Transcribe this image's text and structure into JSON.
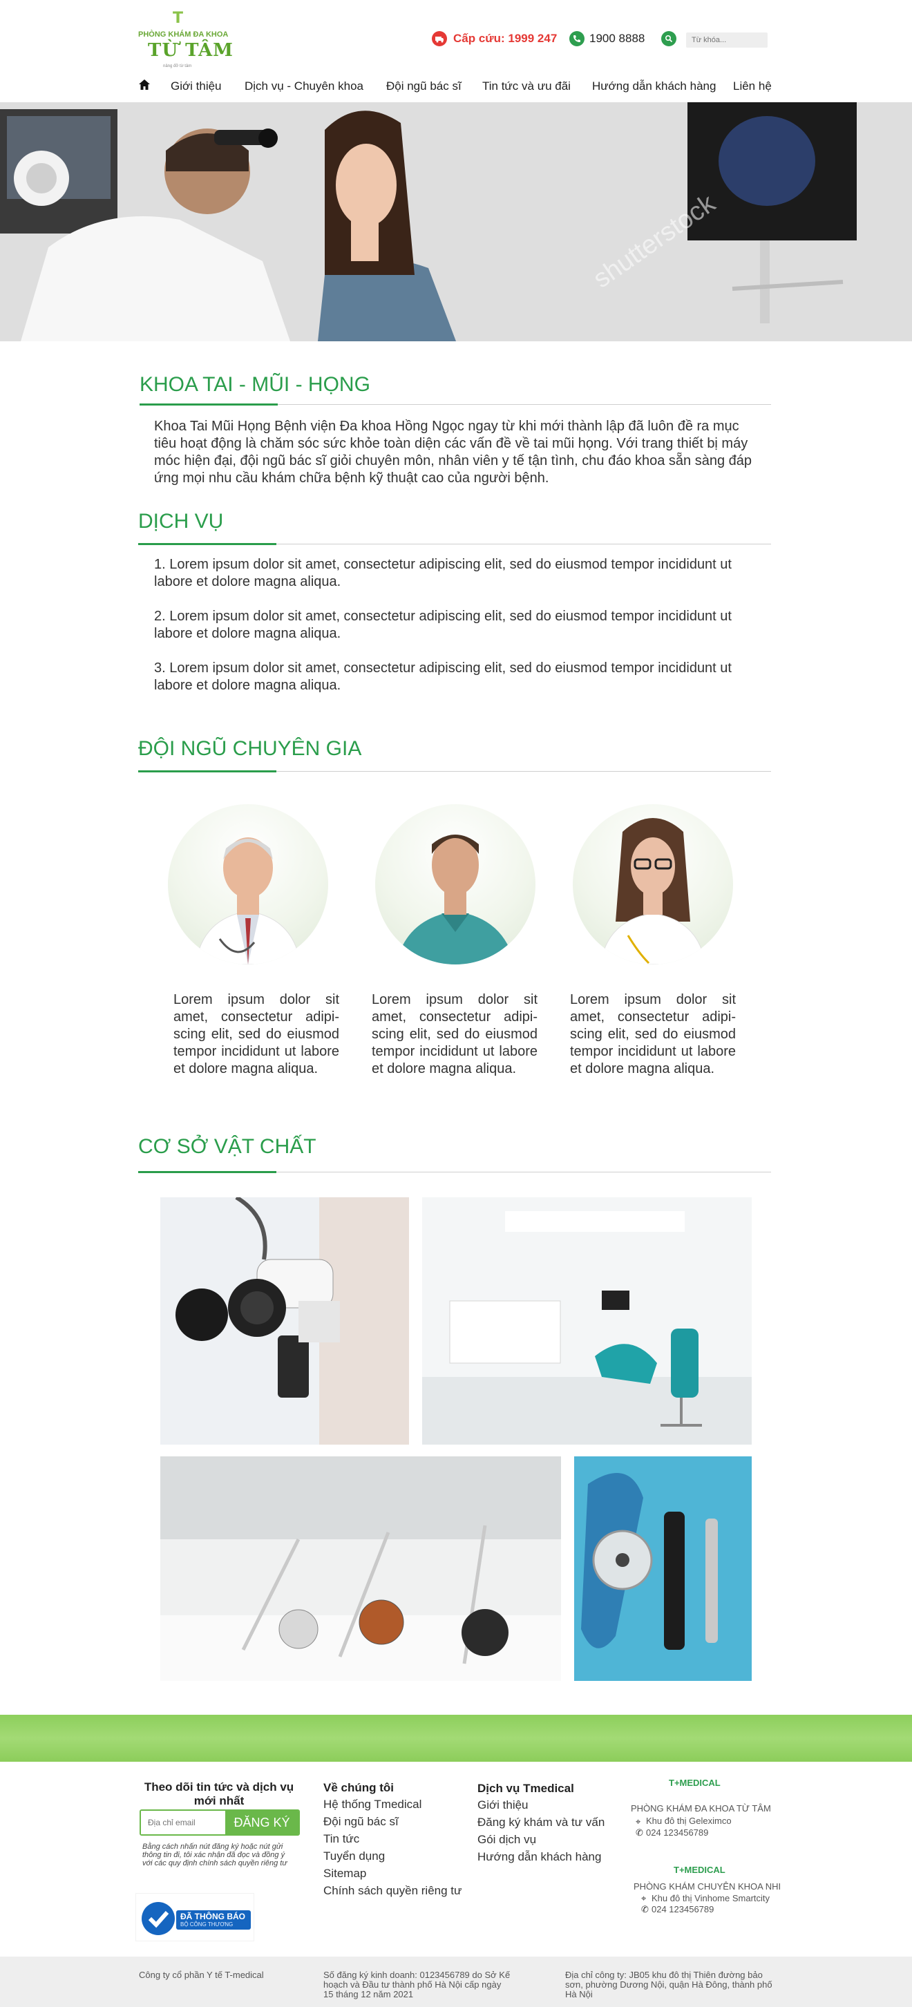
{
  "header": {
    "logo": {
      "mark": "T",
      "line1": "PHÒNG KHÁM ĐA KHOA",
      "line2": "TỪ TÂM",
      "tagline": "nâng đỡ từ tâm"
    },
    "emergency": "Cấp cứu: 1999 247",
    "phone": "1900 8888",
    "search_placeholder": "Từ khóa..."
  },
  "nav": [
    {
      "label": "Giới thiệu"
    },
    {
      "label": "Dịch vụ - Chuyên khoa"
    },
    {
      "label": "Đội ngũ bác sĩ"
    },
    {
      "label": "Tin tức và ưu đãi"
    },
    {
      "label": "Hướng dẫn khách hàng"
    },
    {
      "label": "Liên hệ"
    }
  ],
  "hero": {
    "watermark": "shutterstock"
  },
  "department": {
    "title": "KHOA TAI - MŨI - HỌNG",
    "intro": "Khoa Tai Mũi Họng Bệnh viện Đa khoa Hồng Ngọc ngay từ khi mới thành lập đã luôn đề ra mục tiêu hoạt động là chăm sóc sức khỏe toàn diện các vấn đề về tai mũi họng. Với trang thiết bị máy móc hiện đại, đội ngũ bác sĩ giỏi chuyên môn, nhân viên y tế tận tình, chu đáo khoa sẵn sàng đáp ứng mọi nhu cầu khám chữa bệnh kỹ thuật cao của người bệnh."
  },
  "services": {
    "title": "DỊCH VỤ",
    "items": [
      "1. Lorem ipsum dolor sit amet, consectetur adipiscing elit, sed do eiusmod tempor incididunt ut labore et dolore magna aliqua.",
      "2. Lorem ipsum dolor sit amet, consectetur adipiscing elit, sed do eiusmod tempor incididunt ut labore et dolore magna aliqua.",
      "3. Lorem ipsum dolor sit amet, consectetur adipiscing elit, sed do eiusmod tempor incididunt ut labore et dolore magna aliqua."
    ]
  },
  "experts": {
    "title": "ĐỘI NGŨ CHUYÊN GIA",
    "doctors": [
      {
        "bio": "Lorem ipsum dolor sit amet, consectetur adipi-scing elit, sed do eiusmod tempor incididunt ut labore et dolore magna aliqua.",
        "coat": "#ffffff",
        "skin": "#e8b89a",
        "hair": "#d8d8d8"
      },
      {
        "bio": "Lorem ipsum dolor sit amet, consectetur adipi-scing elit, sed do eiusmod tempor incididunt ut labore et dolore magna aliqua.",
        "coat": "#3f9fa0",
        "skin": "#d9a687",
        "hair": "#4a3324"
      },
      {
        "bio": "Lorem ipsum dolor sit amet, consectetur adipi-scing elit, sed do eiusmod tempor incididunt ut labore et dolore magna aliqua.",
        "coat": "#ffffff",
        "skin": "#eabfa6",
        "hair": "#5a3a28"
      }
    ]
  },
  "facilities": {
    "title": "CƠ SỞ VẬT CHẤT"
  },
  "footer": {
    "newsletter": {
      "title": "Theo dõi tin tức và dịch vụ mới nhất",
      "placeholder": "Địa chỉ email",
      "button": "ĐĂNG KÝ",
      "note": "Bằng cách nhấn nút đăng ký hoặc nút gửi thông tin đi, tôi xác nhận đã đọc và đồng ý với các quy định chính sách quyền riêng tư",
      "badge_line1": "ĐÃ THÔNG BÁO",
      "badge_line2": "BỘ CÔNG THƯƠNG"
    },
    "about": {
      "title": "Về chúng tôi",
      "links": [
        "Hệ thống Tmedical",
        "Đội ngũ bác sĩ",
        "Tin tức",
        "Tuyển dụng",
        "Sitemap",
        "Chính sách quyền riêng tư"
      ]
    },
    "services": {
      "title": "Dịch vụ Tmedical",
      "links": [
        "Giới thiệu",
        "Đăng ký khám và tư vấn",
        "Gói dịch vụ",
        "Hướng dẫn khách hàng"
      ]
    },
    "brands": [
      {
        "logo": "T+MEDICAL",
        "name": "PHÒNG KHÁM ĐA KHOA TỪ TÂM",
        "address": "Khu đô thị Geleximco",
        "phone": "024 123456789"
      },
      {
        "logo": "T+MEDICAL",
        "name": "PHÒNG KHÁM CHUYÊN KHOA NHI",
        "address": "Khu đô thị Vinhome Smartcity",
        "phone": "024 123456789"
      }
    ],
    "bottom": {
      "company": "Công ty cổ phần Y tế T-medical",
      "license": "Số đăng ký kinh doanh: 0123456789 do Sở Kế hoạch và Đầu tư thành phố Hà Nội cấp ngày 15 tháng 12 năm 2021",
      "address": "Địa chỉ công ty: JB05 khu đô thị Thiên đường bảo sơn, phường Dương Nội, quận Hà Đông, thành phố Hà Nội"
    }
  },
  "colors": {
    "brand_green": "#2a9d4b",
    "light_green": "#8bc34a",
    "alert_red": "#e53935"
  }
}
